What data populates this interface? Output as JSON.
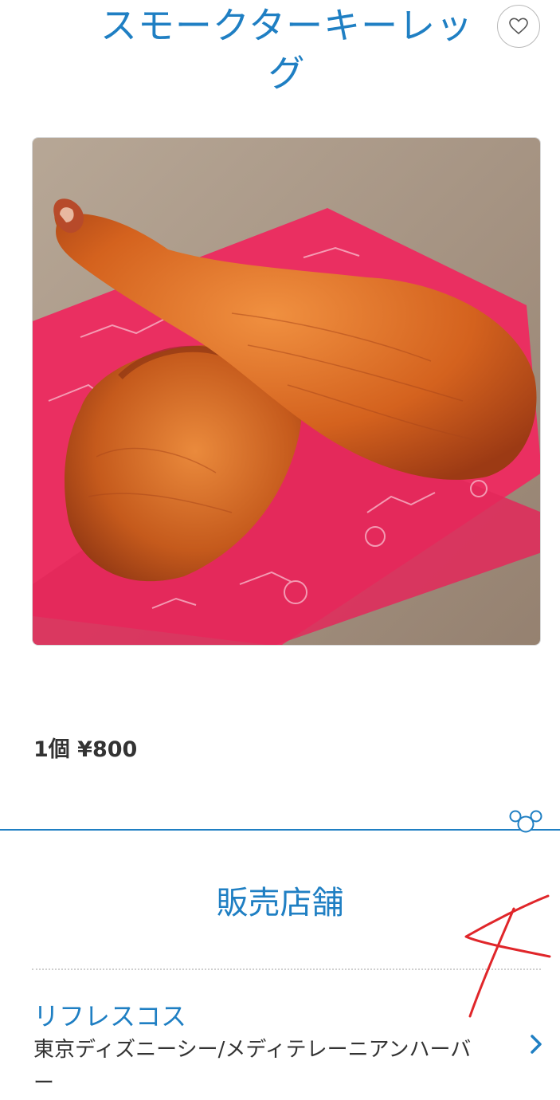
{
  "product": {
    "title": "スモークターキーレッグ",
    "price": "1個 ¥800",
    "favorite_icon": "heart-outline-icon"
  },
  "section": {
    "title": "販売店舗",
    "decoration_icon": "mickey-ears-icon"
  },
  "store": {
    "name": "リフレスコス",
    "location": "東京ディズニーシー/メディテレーニアンハーバー",
    "chevron_icon": "chevron-right-icon"
  },
  "colors": {
    "accent": "#1f7fc3",
    "text": "#333333",
    "annotation": "#e0262a"
  }
}
